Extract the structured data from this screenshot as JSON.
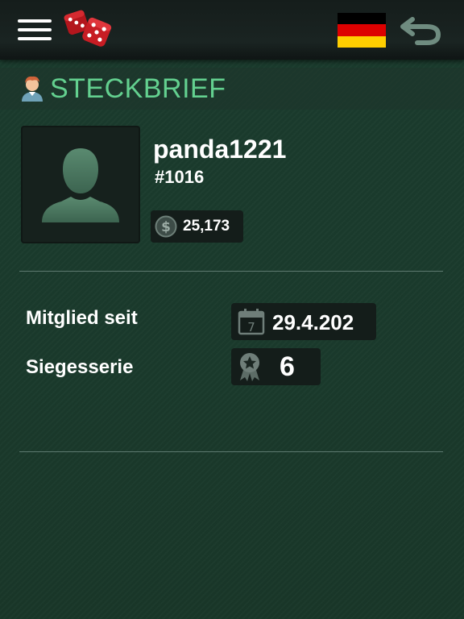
{
  "header": {
    "menu_icon": "hamburger-menu-icon",
    "logo_icon": "dice-icon",
    "flag_icon": "germany-flag-icon",
    "flag_colors": [
      "#000000",
      "#dd0000",
      "#ffce00"
    ],
    "back_icon": "back-arrow-icon"
  },
  "section": {
    "title": "STECKBRIEF",
    "icon": "user-avatar-icon",
    "accent_color": "#63d08f"
  },
  "profile": {
    "picture_icon": "default-profile-silhouette-icon",
    "username": "panda1221",
    "user_id": "#1016",
    "coins_icon": "dollar-coin-icon",
    "coins": "25,173"
  },
  "stats": {
    "member_since_label": "Mitglied seit",
    "member_since_value": "29.4.202",
    "member_since_icon": "calendar-icon",
    "calendar_day": "7",
    "win_streak_label": "Siegesserie",
    "win_streak_value": "6",
    "win_streak_icon": "medal-icon"
  }
}
